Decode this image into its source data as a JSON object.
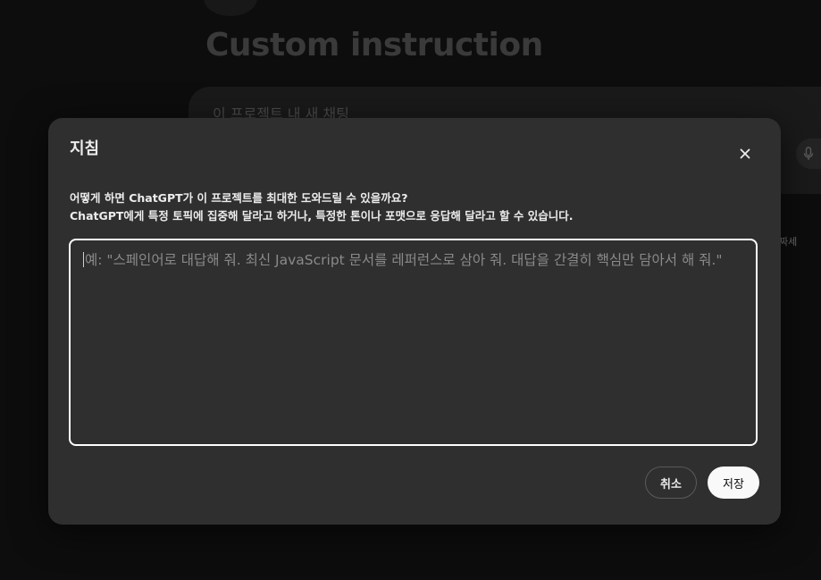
{
  "background": {
    "page_title": "Custom instruction",
    "composer_placeholder": "이 프로젝트 내 새 채팅",
    "side_text": "짜세"
  },
  "modal": {
    "title": "지침",
    "close_icon": "close-icon",
    "description_line1": "어떻게 하면 ChatGPT가 이 프로젝트를 최대한 도와드릴 수 있을까요?",
    "description_line2": "ChatGPT에게 특정 토픽에 집중해 달라고 하거나, 특정한 톤이나 포맷으로 응답해 달라고 할 수 있습니다.",
    "instructions": {
      "value": "",
      "placeholder": "예: \"스페인어로 대답해 줘. 최신 JavaScript 문서를 레퍼런스로 삼아 줘. 대답을 간결히 핵심만 담아서 해 줘.\""
    },
    "cancel_label": "취소",
    "save_label": "저장"
  },
  "colors": {
    "modal_bg": "#2f2f2f",
    "overlay_bg": "#0b0b0b",
    "field_border": "#ffffff",
    "save_button_bg": "#f9f9f9",
    "text_primary": "#ececec",
    "placeholder_text": "#8a8a8a"
  }
}
